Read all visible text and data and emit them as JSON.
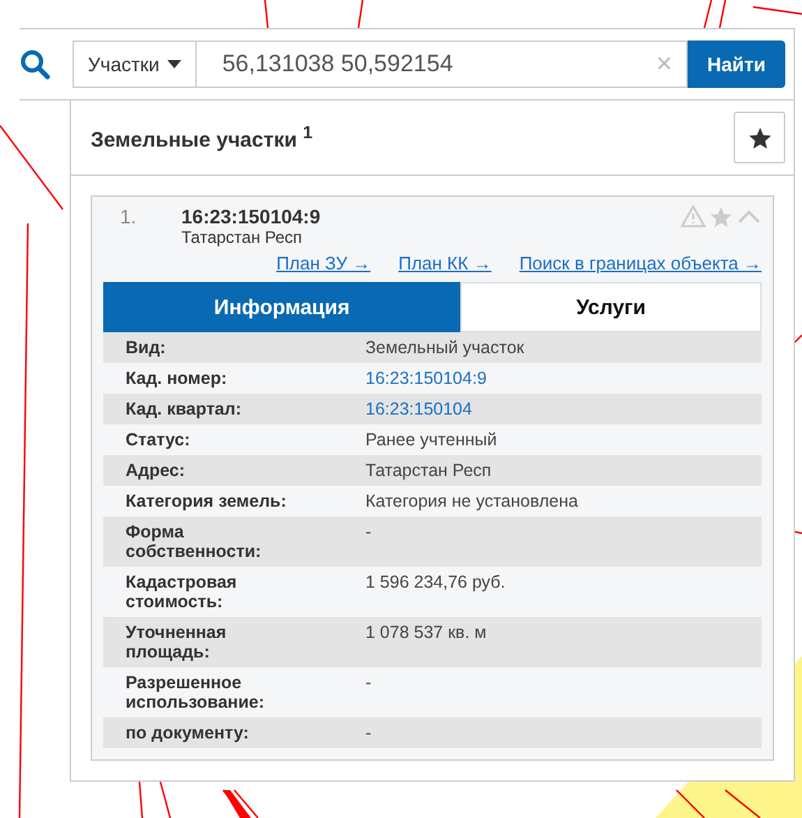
{
  "search": {
    "category": "Участки",
    "value": "56,131038 50,592154",
    "clear": "×",
    "button": "Найти"
  },
  "panel": {
    "title": "Земельные участки $^{1}$",
    "results": [
      {
        "number": "1.",
        "title": "16:23:150104:9",
        "subtitle": "Татарстан Респ",
        "expanded": true,
        "links": [
          "План ЗУ →",
          "План КК →",
          "Поиск в границах объекта →"
        ],
        "tabs": [
          {
            "label": "Информация",
            "selected": true
          },
          {
            "label": "Услуги",
            "selected": false
          }
        ],
        "rows": [
          {
            "label": "Вид:",
            "value": "Земельный участок",
            "kind": "text"
          },
          {
            "label": "Кад. номер:",
            "value": "16:23:150104:9",
            "kind": "link"
          },
          {
            "label": "Кад. квартал:",
            "value": "16:23:150104",
            "kind": "link"
          },
          {
            "label": "Статус:",
            "value": "Ранее учтенный",
            "kind": "text"
          },
          {
            "label": "Адрес:",
            "value": "Татарстан Респ",
            "kind": "text"
          },
          {
            "label": "Категория земель:",
            "value": "Категория не установлена",
            "kind": "text"
          },
          {
            "label": "Форма собственности:",
            "value": "-",
            "kind": "text"
          },
          {
            "label": "Кадастровая стоимость:",
            "value": "1 596 234,76 руб.",
            "kind": "text"
          },
          {
            "label": "Уточненная площадь:",
            "value": "1 078 537 кв. м",
            "kind": "text"
          },
          {
            "label": "Разрешенное использование:",
            "value": "-",
            "kind": "text"
          },
          {
            "label": "по документу:",
            "value": "-",
            "kind": "text"
          }
        ]
      }
    ]
  }
}
